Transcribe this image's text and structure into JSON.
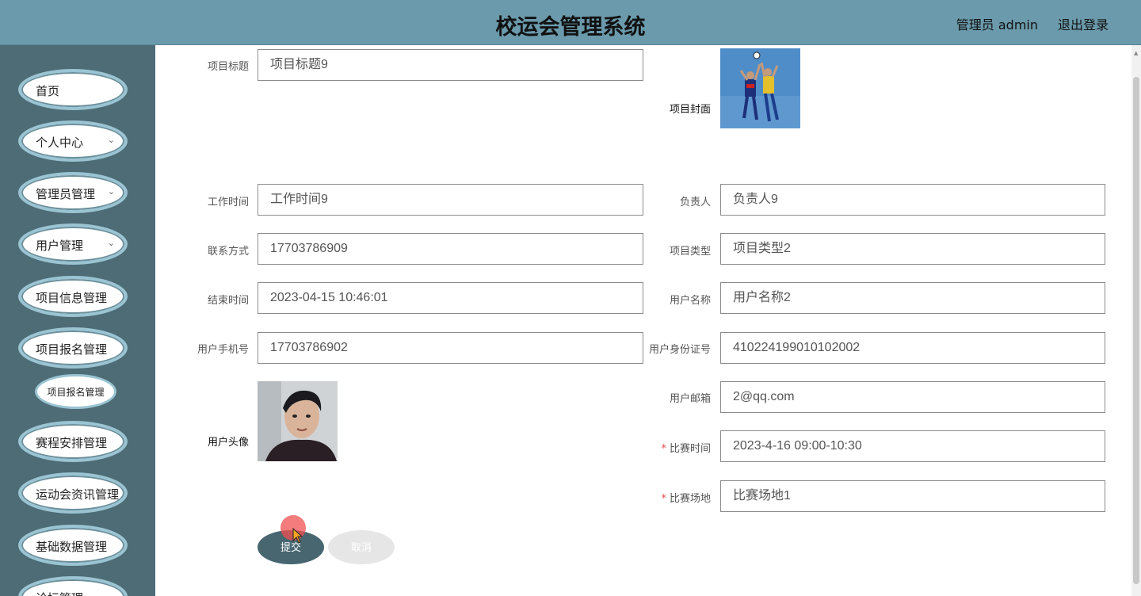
{
  "header": {
    "title": "校运会管理系统",
    "user": "管理员 admin",
    "logout": "退出登录"
  },
  "sidebar": {
    "items": [
      {
        "label": "首页"
      },
      {
        "label": "个人中心"
      },
      {
        "label": "管理员管理"
      },
      {
        "label": "用户管理"
      },
      {
        "label": "项目信息管理"
      },
      {
        "label": "项目报名管理"
      },
      {
        "label": "项目报名管理"
      },
      {
        "label": "赛程安排管理"
      },
      {
        "label": "运动会资讯管理"
      },
      {
        "label": "基础数据管理"
      },
      {
        "label": "论坛管理"
      }
    ]
  },
  "form": {
    "project_title": {
      "label": "项目标题",
      "value": "项目标题9"
    },
    "cover": {
      "label": "项目封面"
    },
    "work_time": {
      "label": "工作时间",
      "value": "工作时间9"
    },
    "manager": {
      "label": "负责人",
      "value": "负责人9"
    },
    "contact": {
      "label": "联系方式",
      "value": "17703786909"
    },
    "project_type": {
      "label": "项目类型",
      "value": "项目类型2"
    },
    "end_time": {
      "label": "结束时间",
      "value": "2023-04-15 10:46:01"
    },
    "user_name": {
      "label": "用户名称",
      "value": "用户名称2"
    },
    "user_phone": {
      "label": "用户手机号",
      "value": "17703786902"
    },
    "user_id_card": {
      "label": "用户身份证号",
      "value": "410224199010102002"
    },
    "avatar": {
      "label": "用户头像"
    },
    "user_email": {
      "label": "用户邮箱",
      "value": "2@qq.com"
    },
    "match_time": {
      "label": "比赛时间",
      "value": "2023-4-16 09:00-10:30",
      "required_mark": "*"
    },
    "match_venue": {
      "label": "比赛场地",
      "value": "比赛场地1",
      "required_mark": "*"
    },
    "submit_label": "提交",
    "cancel_label": "取消"
  }
}
